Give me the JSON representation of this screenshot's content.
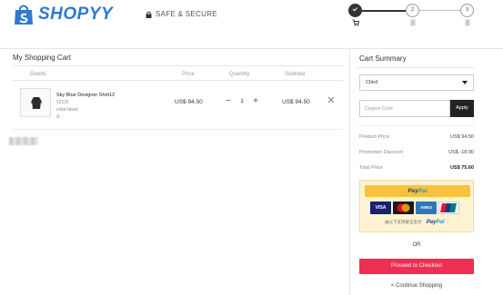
{
  "header": {
    "brand": "SHOPYY",
    "secure_text": "SAFE & SECURE",
    "steps": [
      "2",
      "3"
    ],
    "brand_color": "#2f78d3"
  },
  "cart": {
    "title": "My Shopping Cart",
    "columns": {
      "goods": "Goods",
      "price": "Price",
      "quantity": "Quantity",
      "subtotal": "Subtotal"
    },
    "items": [
      {
        "name": "Sky Blue Designer Shirt12",
        "sku": "13131",
        "variant": "color:black",
        "extra": "S:",
        "price": "US$ 94.50",
        "quantity": "1",
        "subtotal": "US$ 94.50"
      }
    ]
  },
  "summary": {
    "title": "Cart Summary",
    "country": "Chird",
    "coupon_placeholder": "Coupon Code",
    "apply_label": "Apply",
    "rows": [
      {
        "label": "Product Price",
        "value": "US$ 94.50"
      },
      {
        "label": "Promotion Discount",
        "value": "US$ -18.90"
      },
      {
        "label": "Total Price",
        "value": "US$ 75.60"
      }
    ],
    "paypal_dark": "Pay",
    "paypal_light": "Pal",
    "cards": [
      "VISA",
      "MC",
      "AMEX",
      "UnionPay"
    ],
    "paypal_note": "由以下支持安全支付",
    "paypal_note_brand_dark": "Pay",
    "paypal_note_brand_light": "Pal",
    "or_text": "OR",
    "checkout_label": "Proceed to Checkout",
    "continue_label": "< Continue Shopping",
    "checkout_color": "#ee2e52",
    "paypal_color": "#f7c23b"
  }
}
